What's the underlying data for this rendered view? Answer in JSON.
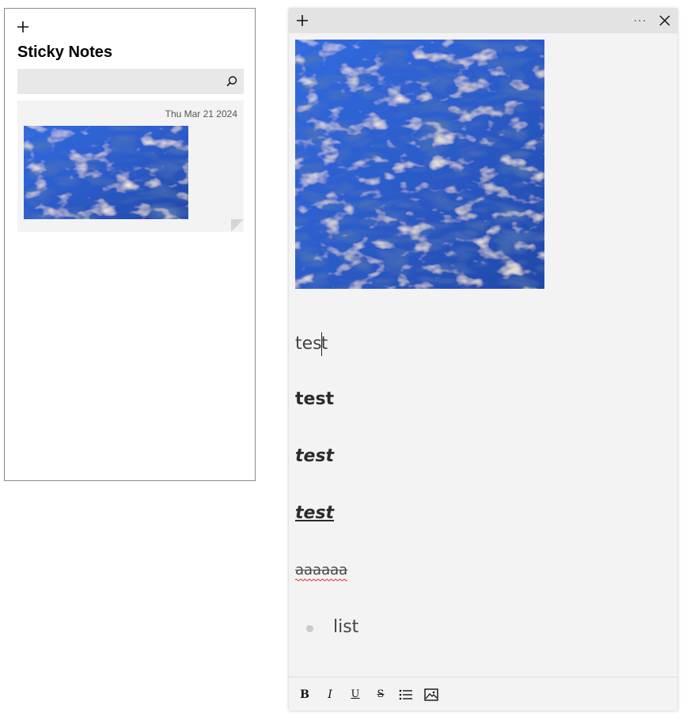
{
  "list_panel": {
    "title": "Sticky Notes",
    "search": {
      "placeholder": "",
      "value": ""
    },
    "notes": [
      {
        "date": "Thu Mar 21 2024",
        "has_image": true
      }
    ]
  },
  "editor": {
    "more_label": "···",
    "lines": {
      "plain": "test",
      "bold": "test",
      "bold_italic": "test",
      "bold_italic_underline": "test",
      "strikethrough": "aaaaaa",
      "list_item": "list"
    },
    "toolbar": {
      "bold": "B",
      "italic": "I",
      "underline": "U",
      "strikethrough": "S"
    }
  },
  "colors": {
    "panel_background": "#f3f3f3",
    "title_bar": "#e3e3e3",
    "search_background": "#e8e8e8",
    "image_blue": "#2a5fd0"
  },
  "icons": [
    "plus-icon",
    "search-icon",
    "more-icon",
    "close-icon",
    "bulleted-list-icon",
    "image-icon"
  ]
}
